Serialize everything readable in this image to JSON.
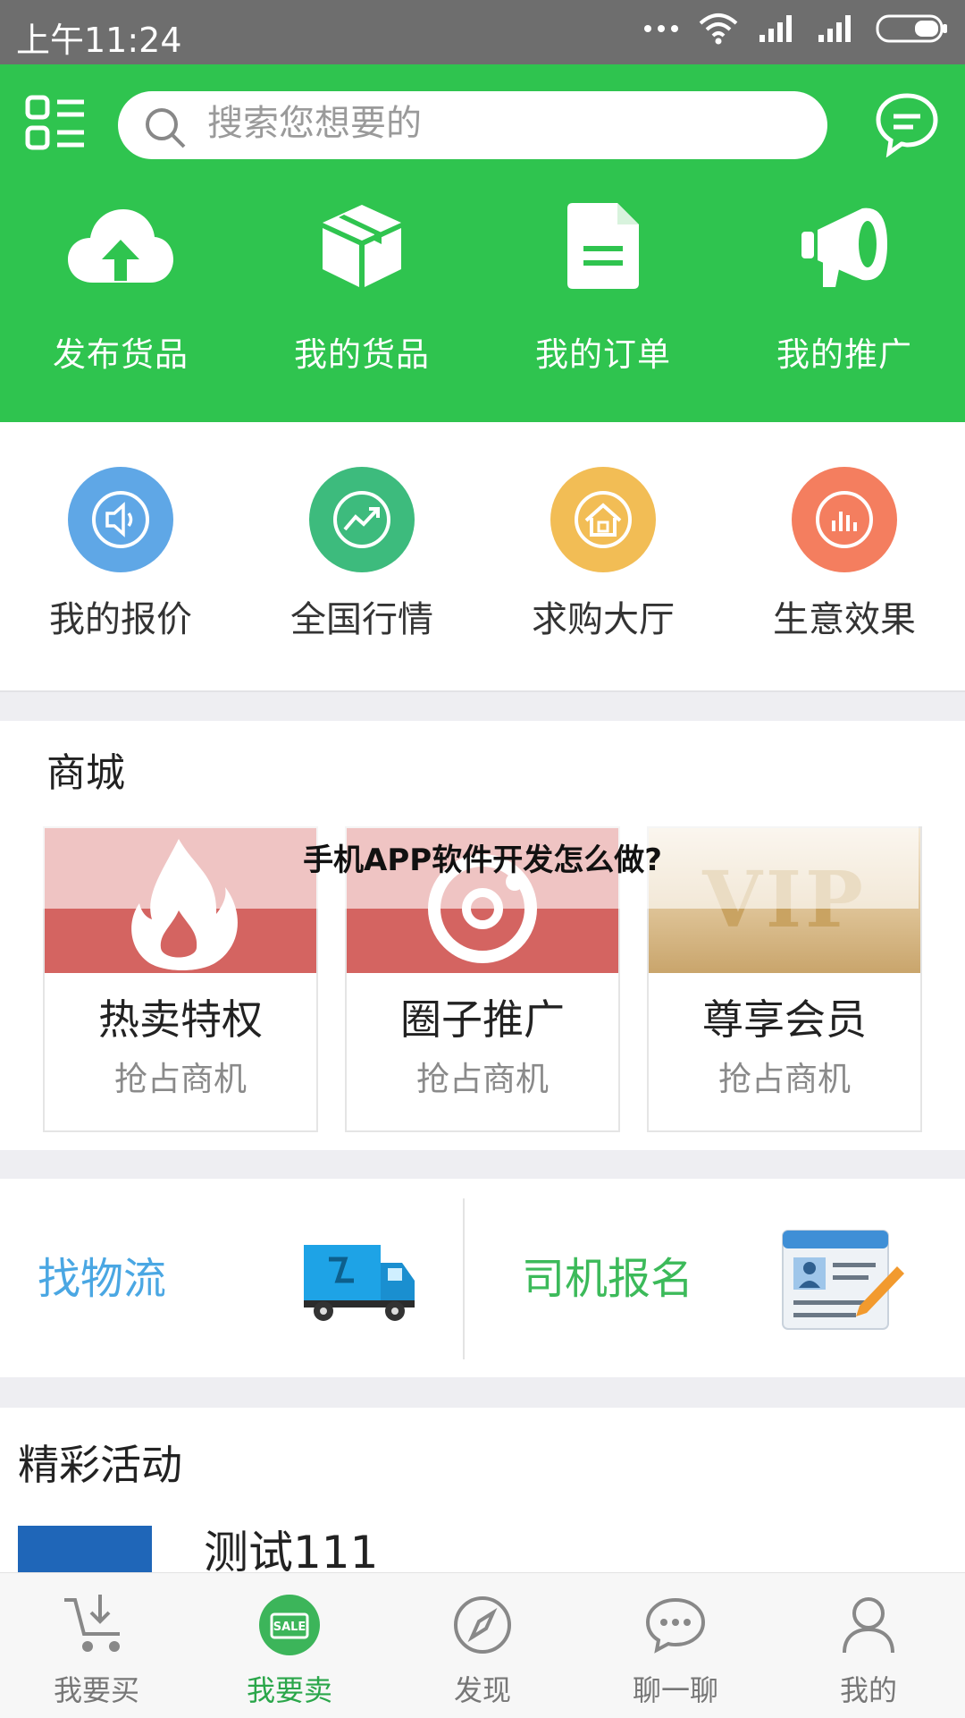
{
  "status_bar": {
    "time": "上午11:24"
  },
  "header": {
    "search_placeholder": "搜索您想要的",
    "quick_actions": [
      {
        "label": "发布货品",
        "icon": "cloud-upload-icon"
      },
      {
        "label": "我的货品",
        "icon": "box-icon"
      },
      {
        "label": "我的订单",
        "icon": "document-icon"
      },
      {
        "label": "我的推广",
        "icon": "megaphone-icon"
      }
    ],
    "colors": {
      "brand": "#2fc44f"
    }
  },
  "shortcuts": [
    {
      "label": "我的报价",
      "icon": "speaker-icon",
      "color": "#5fa7e6"
    },
    {
      "label": "全国行情",
      "icon": "trend-icon",
      "color": "#3dbb7d"
    },
    {
      "label": "求购大厅",
      "icon": "house-icon",
      "color": "#f2bd55"
    },
    {
      "label": "生意效果",
      "icon": "bar-chart-icon",
      "color": "#f47e5f"
    }
  ],
  "mall": {
    "title": "商城",
    "cards": [
      {
        "title": "热卖特权",
        "subtitle": "抢占商机",
        "image_text": ""
      },
      {
        "title": "圈子推广",
        "subtitle": "抢占商机",
        "image_text": ""
      },
      {
        "title": "尊享会员",
        "subtitle": "抢占商机",
        "image_text": "VIP"
      }
    ]
  },
  "watermark": "手机APP软件开发怎么做?",
  "logistics": {
    "find_logistics": "找物流",
    "driver_signup": "司机报名"
  },
  "activities": {
    "title": "精彩活动",
    "items": [
      {
        "name": "测试111"
      }
    ]
  },
  "tabbar": [
    {
      "label": "我要买",
      "icon": "cart-icon",
      "active": false
    },
    {
      "label": "我要卖",
      "icon": "sale-icon",
      "active": true
    },
    {
      "label": "发现",
      "icon": "compass-icon",
      "active": false
    },
    {
      "label": "聊一聊",
      "icon": "chat-bubble-icon",
      "active": false
    },
    {
      "label": "我的",
      "icon": "user-icon",
      "active": false
    }
  ]
}
